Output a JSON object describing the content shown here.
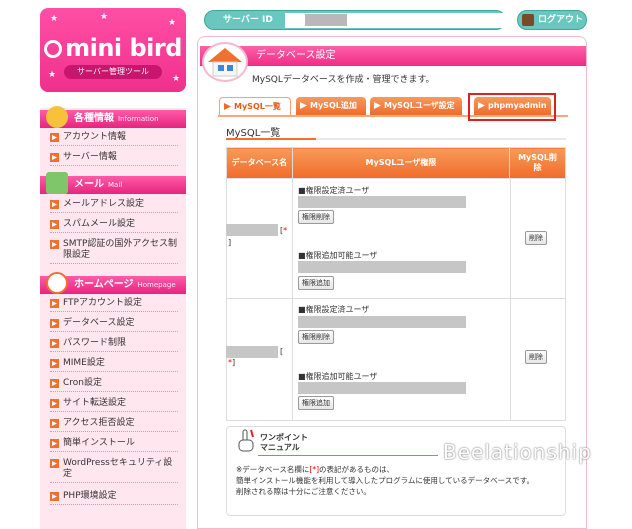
{
  "logo": {
    "brand": "mini bird",
    "sub": "サーバー管理ツール"
  },
  "sidebar": {
    "sections": [
      {
        "title": "各種情報",
        "en": "Information",
        "icon": "duck-icon",
        "items": [
          "アカウント情報",
          "サーバー情報"
        ]
      },
      {
        "title": "メール",
        "en": "Mail",
        "icon": "mail-icon",
        "items": [
          "メールアドレス設定",
          "スパムメール設定",
          "SMTP認証の国外アクセス制限設定"
        ]
      },
      {
        "title": "ホームページ",
        "en": "Homepage",
        "icon": "homepage-icon",
        "items": [
          "FTPアカウント設定",
          "データベース設定",
          "パスワード制限",
          "MIME設定",
          "Cron設定",
          "サイト転送設定",
          "アクセス拒否設定",
          "簡単インストール",
          "WordPressセキュリティ設定",
          "PHP環境設定"
        ]
      }
    ]
  },
  "topbar": {
    "server_id_label": "サーバー ID",
    "logout": "ログアウト"
  },
  "page": {
    "title": "データベース設定",
    "description": "MySQLデータベースを作成・管理できます。",
    "tabs": [
      "MySQL一覧",
      "MySQL追加",
      "MySQLユーザ設定",
      "phpmyadmin"
    ],
    "subtitle": "MySQL一覧",
    "table": {
      "headers": [
        "データベース名",
        "MySQLユーザ権限",
        "MySQL削除"
      ],
      "rows": [
        {
          "db_suffix": "[",
          "db_suffix_red": "*",
          "db_close": "]",
          "set_label": "■権限設定済ユーザ",
          "set_btn": "権限削除",
          "add_label": "■権限追加可能ユーザ",
          "add_btn": "権限追加",
          "delete_btn": "削除"
        },
        {
          "db_suffix": "[",
          "db_suffix_red": "*",
          "db_close": "]",
          "set_label": "■権限設定済ユーザ",
          "set_btn": "権限削除",
          "add_label": "■権限追加可能ユーザ",
          "add_btn": "権限追加",
          "delete_btn": "削除"
        }
      ]
    },
    "onepoint": {
      "title1": "ワンポイント",
      "title2": "マニュアル",
      "note1a": "※データベース名欄に",
      "note1b": "[*]",
      "note1c": "の表記があるものは、",
      "note2": "簡単インストール機能を利用して導入したプログラムに使用しているデータベースです。",
      "note3": "削除される際は十分にご注意ください。"
    }
  },
  "watermark": "Beelationship",
  "colors": {
    "pink": "#ee2d86",
    "orange": "#ef6c2c",
    "teal": "#6ac7c0",
    "highlight": "#e02020"
  }
}
